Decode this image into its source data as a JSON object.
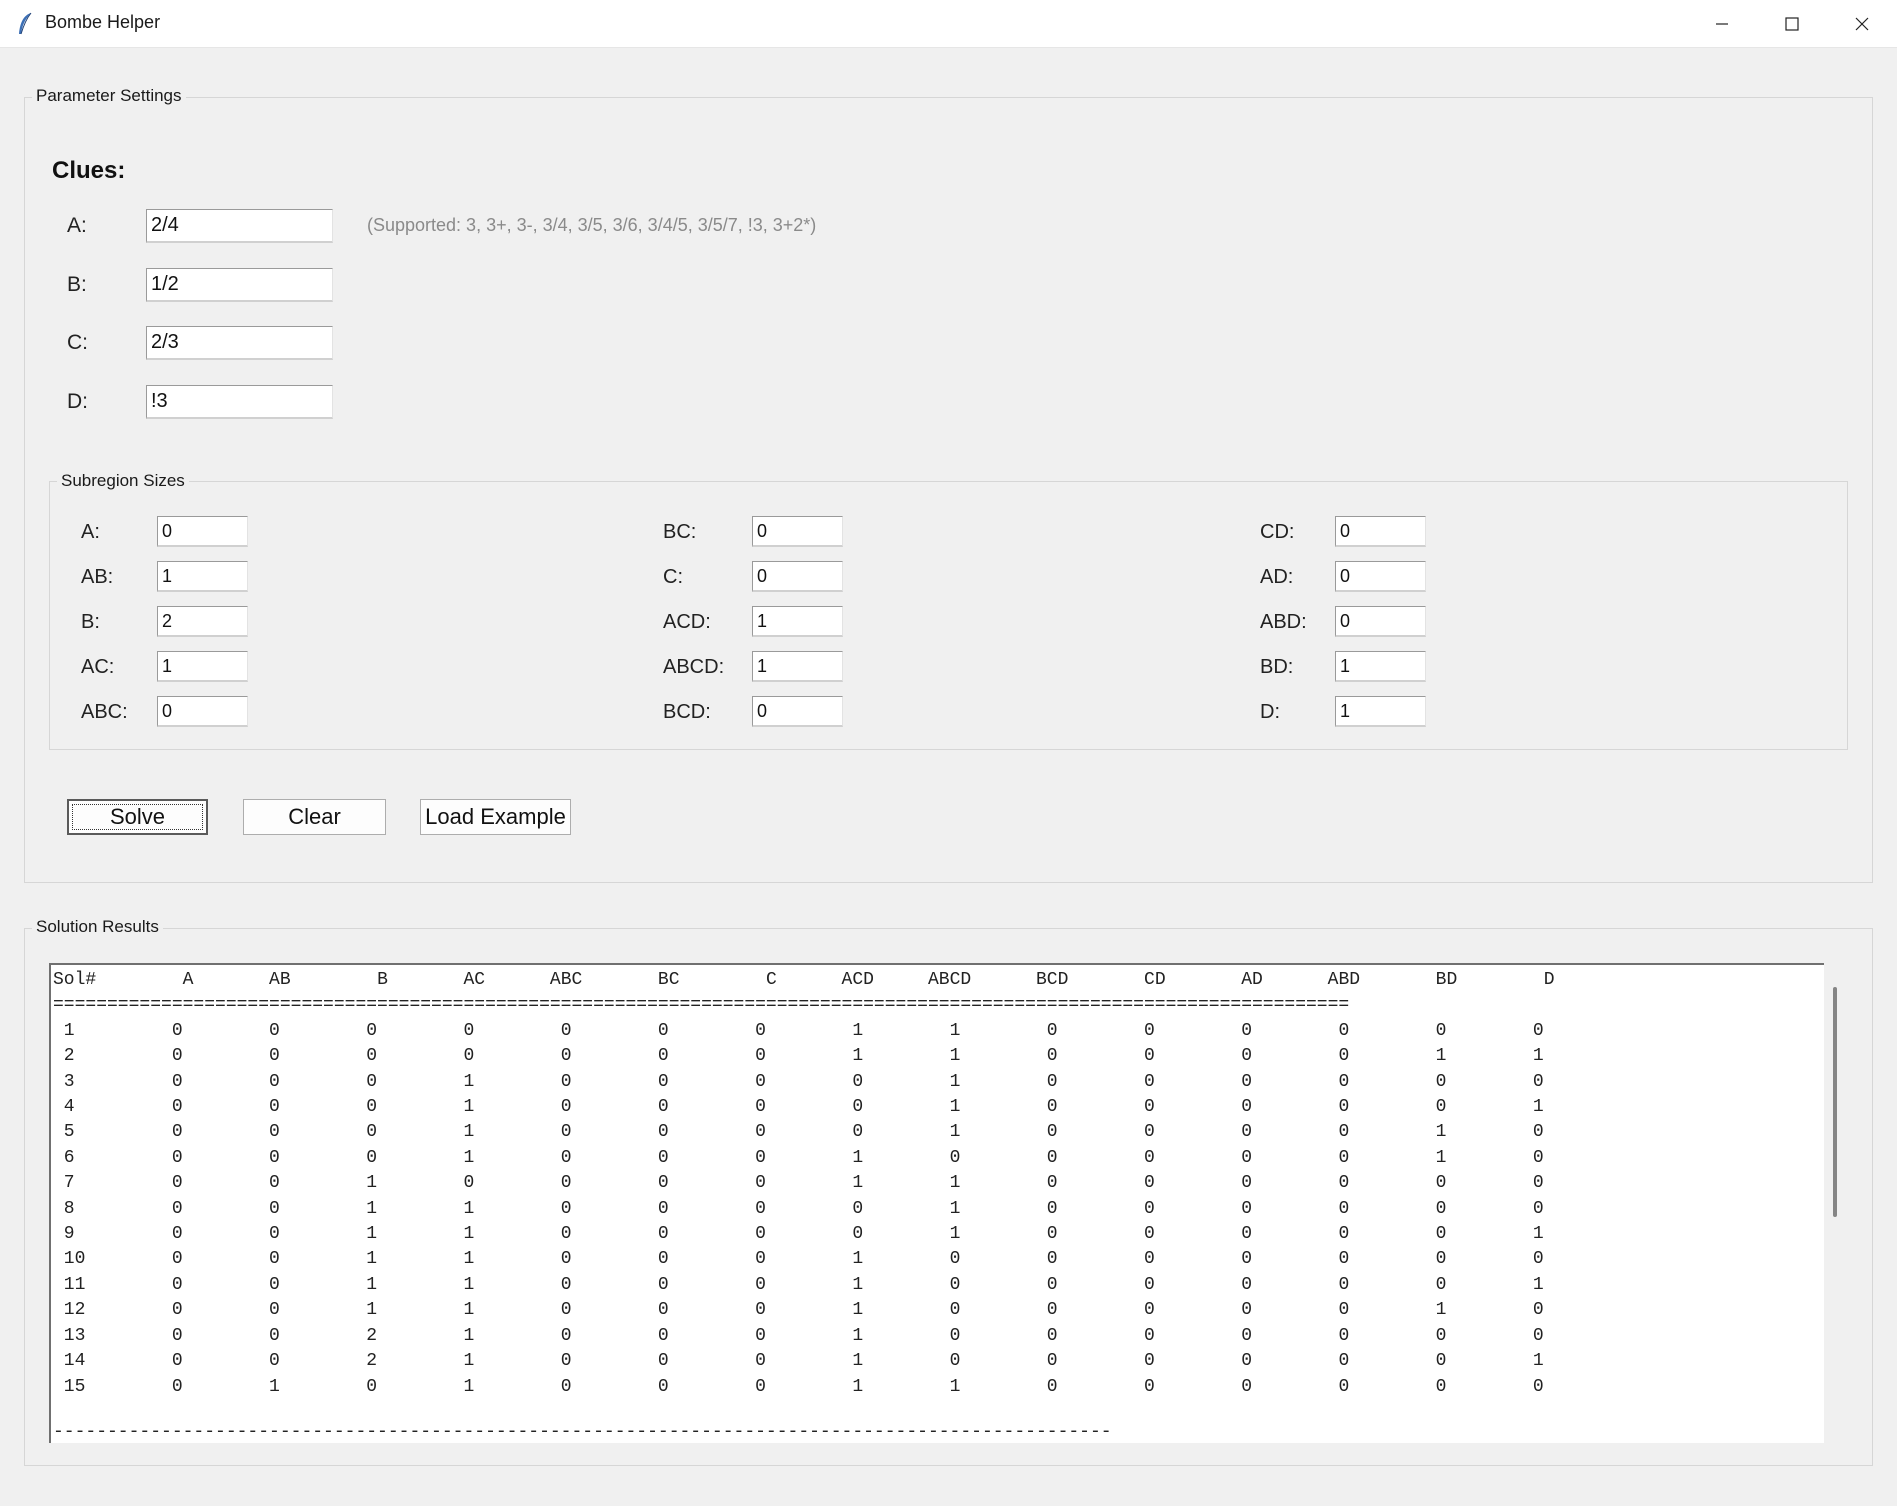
{
  "window": {
    "title": "Bombe Helper",
    "controls": {
      "minimize": "minimize-icon",
      "maximize": "maximize-icon",
      "close": "close-icon"
    }
  },
  "params": {
    "group_label": "Parameter Settings",
    "clues_title": "Clues:",
    "hint": "(Supported: 3, 3+, 3-, 3/4, 3/5, 3/6, 3/4/5, 3/5/7, !3, 3+2*)",
    "clues": [
      {
        "label": "A:",
        "value": "2/4"
      },
      {
        "label": "B:",
        "value": "1/2"
      },
      {
        "label": "C:",
        "value": "2/3"
      },
      {
        "label": "D:",
        "value": "!3"
      }
    ]
  },
  "subregions": {
    "group_label": "Subregion Sizes",
    "columns": [
      [
        {
          "label": "A:",
          "value": "0"
        },
        {
          "label": "AB:",
          "value": "1"
        },
        {
          "label": "B:",
          "value": "2"
        },
        {
          "label": "AC:",
          "value": "1"
        },
        {
          "label": "ABC:",
          "value": "0"
        }
      ],
      [
        {
          "label": "BC:",
          "value": "0"
        },
        {
          "label": "C:",
          "value": "0"
        },
        {
          "label": "ACD:",
          "value": "1"
        },
        {
          "label": "ABCD:",
          "value": "1"
        },
        {
          "label": "BCD:",
          "value": "0"
        }
      ],
      [
        {
          "label": "CD:",
          "value": "0"
        },
        {
          "label": "AD:",
          "value": "0"
        },
        {
          "label": "ABD:",
          "value": "0"
        },
        {
          "label": "BD:",
          "value": "1"
        },
        {
          "label": "D:",
          "value": "1"
        }
      ]
    ]
  },
  "buttons": {
    "solve": "Solve",
    "clear": "Clear",
    "load_example": "Load Example"
  },
  "results": {
    "group_label": "Solution Results",
    "columns": [
      "Sol#",
      "A",
      "AB",
      "B",
      "AC",
      "ABC",
      "BC",
      "C",
      "ACD",
      "ABCD",
      "BCD",
      "CD",
      "AD",
      "ABD",
      "BD",
      "D"
    ],
    "separator": "========================================================================================================================",
    "rows": [
      [
        "1",
        "0",
        "0",
        "0",
        "0",
        "0",
        "0",
        "0",
        "1",
        "1",
        "0",
        "0",
        "0",
        "0",
        "0",
        "0"
      ],
      [
        "2",
        "0",
        "0",
        "0",
        "0",
        "0",
        "0",
        "0",
        "1",
        "1",
        "0",
        "0",
        "0",
        "0",
        "1",
        "1"
      ],
      [
        "3",
        "0",
        "0",
        "0",
        "1",
        "0",
        "0",
        "0",
        "0",
        "1",
        "0",
        "0",
        "0",
        "0",
        "0",
        "0"
      ],
      [
        "4",
        "0",
        "0",
        "0",
        "1",
        "0",
        "0",
        "0",
        "0",
        "1",
        "0",
        "0",
        "0",
        "0",
        "0",
        "1"
      ],
      [
        "5",
        "0",
        "0",
        "0",
        "1",
        "0",
        "0",
        "0",
        "0",
        "1",
        "0",
        "0",
        "0",
        "0",
        "1",
        "0"
      ],
      [
        "6",
        "0",
        "0",
        "0",
        "1",
        "0",
        "0",
        "0",
        "1",
        "0",
        "0",
        "0",
        "0",
        "0",
        "1",
        "0"
      ],
      [
        "7",
        "0",
        "0",
        "1",
        "0",
        "0",
        "0",
        "0",
        "1",
        "1",
        "0",
        "0",
        "0",
        "0",
        "0",
        "0"
      ],
      [
        "8",
        "0",
        "0",
        "1",
        "1",
        "0",
        "0",
        "0",
        "0",
        "1",
        "0",
        "0",
        "0",
        "0",
        "0",
        "0"
      ],
      [
        "9",
        "0",
        "0",
        "1",
        "1",
        "0",
        "0",
        "0",
        "0",
        "1",
        "0",
        "0",
        "0",
        "0",
        "0",
        "1"
      ],
      [
        "10",
        "0",
        "0",
        "1",
        "1",
        "0",
        "0",
        "0",
        "1",
        "0",
        "0",
        "0",
        "0",
        "0",
        "0",
        "0"
      ],
      [
        "11",
        "0",
        "0",
        "1",
        "1",
        "0",
        "0",
        "0",
        "1",
        "0",
        "0",
        "0",
        "0",
        "0",
        "0",
        "1"
      ],
      [
        "12",
        "0",
        "0",
        "1",
        "1",
        "0",
        "0",
        "0",
        "1",
        "0",
        "0",
        "0",
        "0",
        "0",
        "1",
        "0"
      ],
      [
        "13",
        "0",
        "0",
        "2",
        "1",
        "0",
        "0",
        "0",
        "1",
        "0",
        "0",
        "0",
        "0",
        "0",
        "0",
        "0"
      ],
      [
        "14",
        "0",
        "0",
        "2",
        "1",
        "0",
        "0",
        "0",
        "1",
        "0",
        "0",
        "0",
        "0",
        "0",
        "0",
        "1"
      ],
      [
        "15",
        "0",
        "1",
        "0",
        "1",
        "0",
        "0",
        "0",
        "1",
        "1",
        "0",
        "0",
        "0",
        "0",
        "0",
        "0"
      ]
    ],
    "footer": "--------------------------------------------------------------------------------------------------"
  }
}
